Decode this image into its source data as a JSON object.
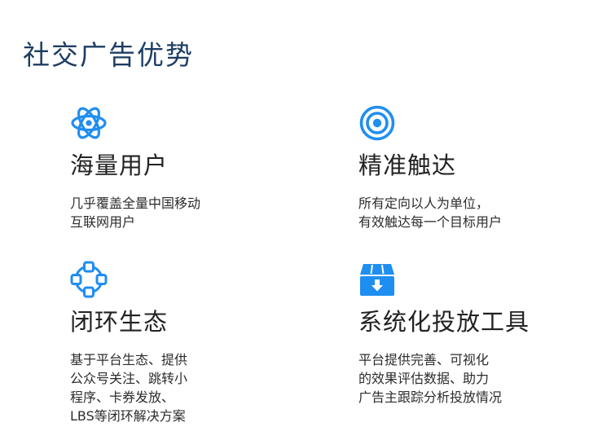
{
  "page": {
    "title": "社交广告优势"
  },
  "colors": {
    "accent": "#1f8ef1",
    "title": "#1d3d63",
    "text": "#222222"
  },
  "features": [
    {
      "icon": "atom-icon",
      "title": "海量用户",
      "desc": [
        "几乎覆盖全量中国移动",
        "互联网用户"
      ]
    },
    {
      "icon": "target-icon",
      "title": "精准触达",
      "desc": [
        "所有定向以人为单位，",
        "有效触达每一个目标用户"
      ]
    },
    {
      "icon": "network-ring-icon",
      "title": "闭环生态",
      "desc": [
        "基于平台生态、提供",
        "公众号关注、跳转小",
        "程序、卡券发放、",
        "LBS等闭环解决方案"
      ]
    },
    {
      "icon": "download-box-icon",
      "title": "系统化投放工具",
      "desc": [
        "平台提供完善、可视化",
        "的效果评估数据、助力",
        "广告主跟踪分析投放情况"
      ]
    }
  ]
}
